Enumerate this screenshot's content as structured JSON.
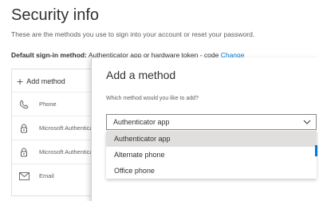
{
  "page": {
    "title": "Security info",
    "subtitle": "These are the methods you use to sign into your account or reset your password.",
    "default_label": "Default sign-in method:",
    "default_value": "Authenticator app or hardware token - code",
    "change_link": "Change"
  },
  "methods_panel": {
    "add_method_label": "Add method",
    "rows": [
      {
        "label": "Phone",
        "icon": "phone-icon"
      },
      {
        "label": "Microsoft Authenticator",
        "icon": "lock-icon"
      },
      {
        "label": "Microsoft Authenticator",
        "icon": "lock-icon"
      },
      {
        "label": "Email",
        "icon": "mail-icon"
      }
    ]
  },
  "dialog": {
    "title": "Add a method",
    "question": "Which method would you like to add?",
    "selected_value": "Authenticator app",
    "options": [
      "Authenticator app",
      "Alternate phone",
      "Office phone"
    ],
    "selected_index": 0
  },
  "colors": {
    "accent": "#0078d4",
    "text": "#323130",
    "muted": "#605e5c",
    "selected_option_bg": "#e1dfdd"
  }
}
